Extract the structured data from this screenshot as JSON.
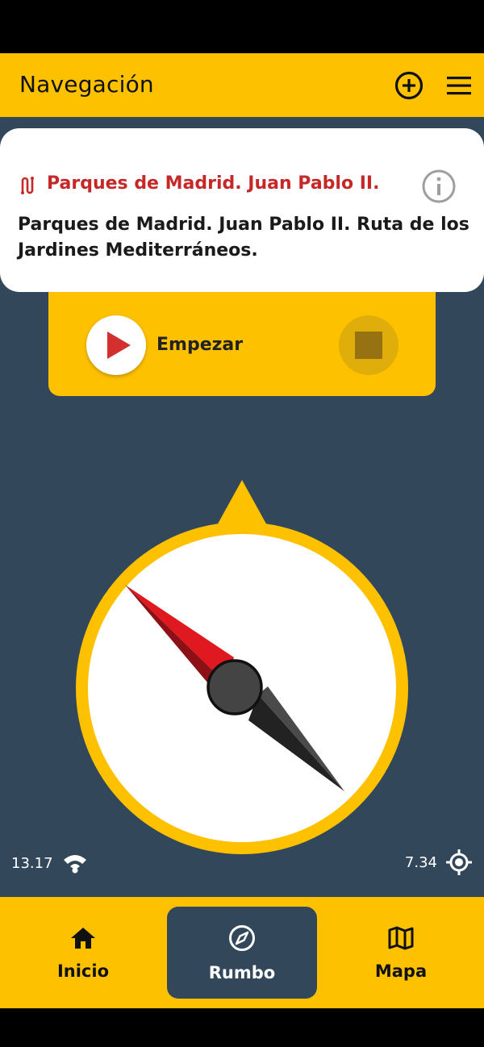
{
  "app_bar": {
    "title": "Navegación"
  },
  "route_card": {
    "name": "Parques de Madrid. Juan Pablo II.",
    "description": "Parques de Madrid. Juan Pablo II. Ruta de los Jardines Mediterráneos."
  },
  "controls": {
    "start_label": "Empezar"
  },
  "gps": {
    "signal_value": "13.17",
    "accuracy_value": "7.34"
  },
  "nav": {
    "items": [
      {
        "label": "Inicio",
        "icon": "home-icon"
      },
      {
        "label": "Rumbo",
        "icon": "compass-icon",
        "active": true
      },
      {
        "label": "Mapa",
        "icon": "map-icon"
      }
    ]
  },
  "colors": {
    "accent": "#FDC100",
    "background": "#32485A",
    "route_red": "#C62828",
    "needle_red": "#E01820"
  }
}
